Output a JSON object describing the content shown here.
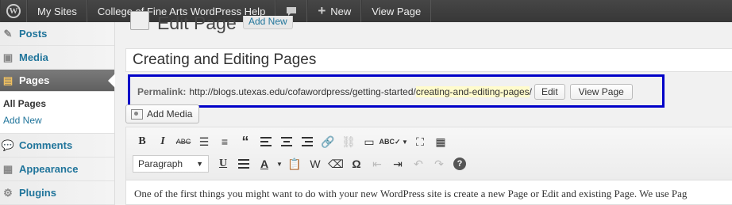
{
  "admin_bar": {
    "items": [
      {
        "label": "My Sites"
      },
      {
        "label": "College of Fine Arts WordPress Help"
      },
      {
        "label": ""
      },
      {
        "label": "New"
      },
      {
        "label": "View Page"
      }
    ]
  },
  "sidebar": {
    "items": [
      {
        "label": "Posts",
        "icon": "pushpin-icon"
      },
      {
        "label": "Media",
        "icon": "media-icon"
      },
      {
        "label": "Pages",
        "icon": "pages-icon",
        "active": true
      },
      {
        "label": "Comments",
        "icon": "comment-icon"
      },
      {
        "label": "Appearance",
        "icon": "appearance-icon"
      },
      {
        "label": "Plugins",
        "icon": "plugin-icon"
      }
    ],
    "submenu": [
      {
        "label": "All Pages",
        "current": true
      },
      {
        "label": "Add New"
      }
    ]
  },
  "main": {
    "heading": "Edit Page",
    "add_new": "Add New",
    "title_value": "Creating and Editing Pages",
    "permalink": {
      "label": "Permalink:",
      "url_base": "http://blogs.utexas.edu/cofawordpress/getting-started/",
      "slug": "creating-and-editing-pages",
      "trailing": "/",
      "edit_button": "Edit",
      "view_button": "View Page"
    },
    "add_media": "Add Media",
    "format_select": "Paragraph",
    "content": "One of the first things you might want to do with your new WordPress site is create a new Page or Edit and existing Page. We use Pag"
  },
  "colors": {
    "highlight_border": "#0000c8",
    "link": "#21759b",
    "admin_bar": "#464646",
    "slug_highlight": "#fffbcc"
  }
}
